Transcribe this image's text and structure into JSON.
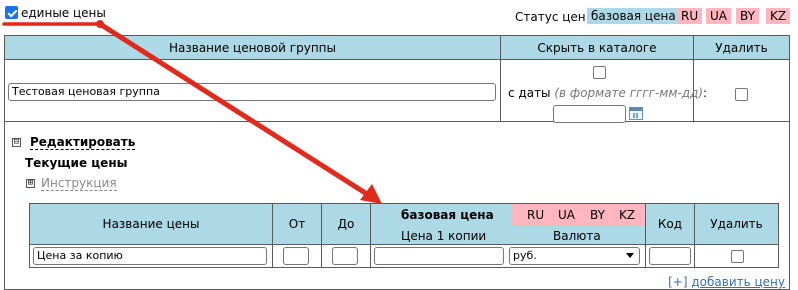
{
  "top": {
    "uniform_prices_label": "единые цены",
    "uniform_prices_checked": true,
    "status_label": "Статус цен:",
    "status_base": "базовая цена",
    "status_countries": [
      "RU",
      "UA",
      "BY",
      "KZ"
    ]
  },
  "group_table": {
    "headers": {
      "name": "Название ценовой группы",
      "hide": "Скрыть в каталоге",
      "delete": "Удалить"
    },
    "group_name_value": "Тестовая ценовая группа",
    "from_date_label": "с даты",
    "from_date_hint": "(в формате гггг-мм-дд)",
    "from_date_colon": ":",
    "from_date_value": ""
  },
  "edit": {
    "expand_glyph": "⊟",
    "edit_label": "Редактировать",
    "current_prices_label": "Текущие цены",
    "instr_glyph": "⊞",
    "instructions_label": "Инструкция"
  },
  "prices_table": {
    "headers": {
      "price_name": "Название цены",
      "from": "От",
      "to": "До",
      "base": "базовая цена",
      "per_copy": "Цена 1 копии",
      "currency": "Валюта",
      "code": "Код",
      "delete": "Удалить"
    },
    "countries": [
      "RU",
      "UA",
      "BY",
      "KZ"
    ],
    "row": {
      "price_name": "Цена за копию",
      "from": "",
      "to": "",
      "per_copy": "",
      "currency": "руб.",
      "code": ""
    },
    "add_prefix": "[+]",
    "add_link": "добавить цену"
  },
  "colors": {
    "header_bg": "#add8e6",
    "country_bg": "#ffb6c1",
    "annotation_red": "#e02a1b"
  }
}
